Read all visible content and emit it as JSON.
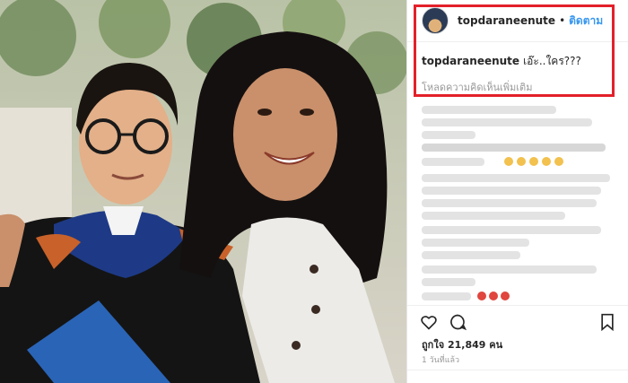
{
  "post": {
    "username": "topdaraneenute",
    "separator": "•",
    "follow_label": "ติดตาม",
    "caption_user": "topdaraneenute",
    "caption_text": "เอ๊ะ..ใคร???",
    "load_more_comments": "โหลดความคิดเห็นเพิ่มเติม",
    "likes_text": "ถูกใจ 21,849 คน",
    "time_ago": "1 วันที่แล้ว"
  },
  "icons": {
    "like": "heart-icon",
    "comment": "comment-bubble-icon",
    "save": "bookmark-icon",
    "avatar": "profile-avatar"
  },
  "colors": {
    "highlight_border": "#e3202a",
    "follow_link": "#3897f0",
    "text": "#262626",
    "muted": "#999999"
  }
}
